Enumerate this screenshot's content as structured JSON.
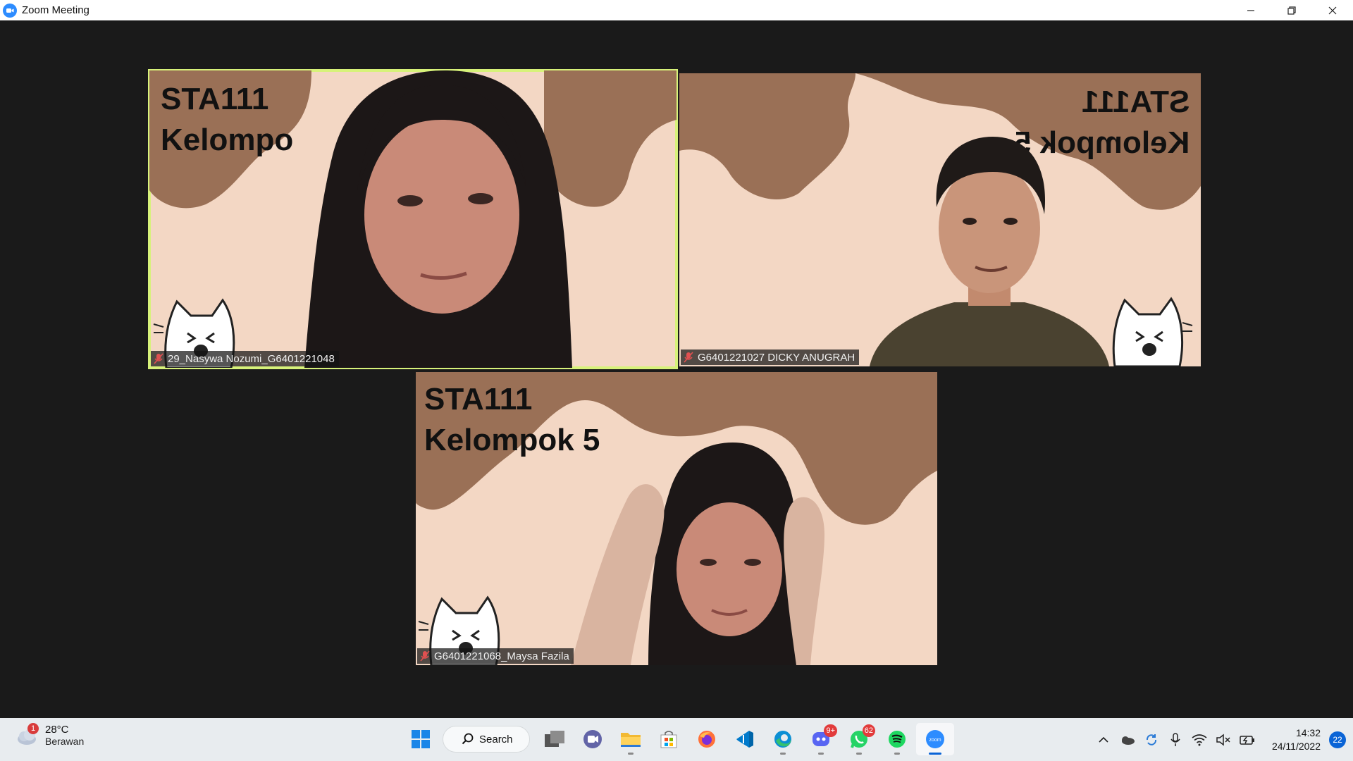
{
  "window": {
    "title": "Zoom Meeting",
    "controls": {
      "minimize": "—",
      "restore": "❐",
      "close": "✕"
    }
  },
  "participants": [
    {
      "name": "29_Nasywa Nozumi_G6401221048",
      "bg_title_line1": "STA111",
      "bg_title_line2": "Kelompo",
      "muted": true,
      "speaking": true,
      "mirrored": false
    },
    {
      "name": "G6401221027 DICKY ANUGRAH",
      "bg_title_line1": "STA111",
      "bg_title_line2": "Kelompok 5",
      "muted": true,
      "speaking": false,
      "mirrored": true
    },
    {
      "name": "G6401221068_Maysa Fazila",
      "bg_title_line1": "STA111",
      "bg_title_line2": "Kelompok 5",
      "muted": true,
      "speaking": false,
      "mirrored": false
    }
  ],
  "colors": {
    "background": "#1a1a1a",
    "tile_bg": "#f3d7c4",
    "blob": "#9a7056",
    "active_border": "#d7f27a"
  },
  "taskbar": {
    "weather": {
      "temp": "28°C",
      "desc": "Berawan",
      "badge": "1"
    },
    "search_label": "Search",
    "apps": [
      {
        "name": "start-icon"
      },
      {
        "name": "task-view-icon"
      },
      {
        "name": "teams-chat-icon"
      },
      {
        "name": "file-explorer-icon"
      },
      {
        "name": "microsoft-store-icon"
      },
      {
        "name": "firefox-icon"
      },
      {
        "name": "vs-code-icon"
      },
      {
        "name": "edge-icon"
      },
      {
        "name": "discord-icon",
        "badge": "9+"
      },
      {
        "name": "whatsapp-icon",
        "badge": "62"
      },
      {
        "name": "spotify-icon"
      },
      {
        "name": "zoom-icon"
      }
    ],
    "tray": {
      "time": "14:32",
      "date": "24/11/2022",
      "notifications": "22"
    }
  }
}
